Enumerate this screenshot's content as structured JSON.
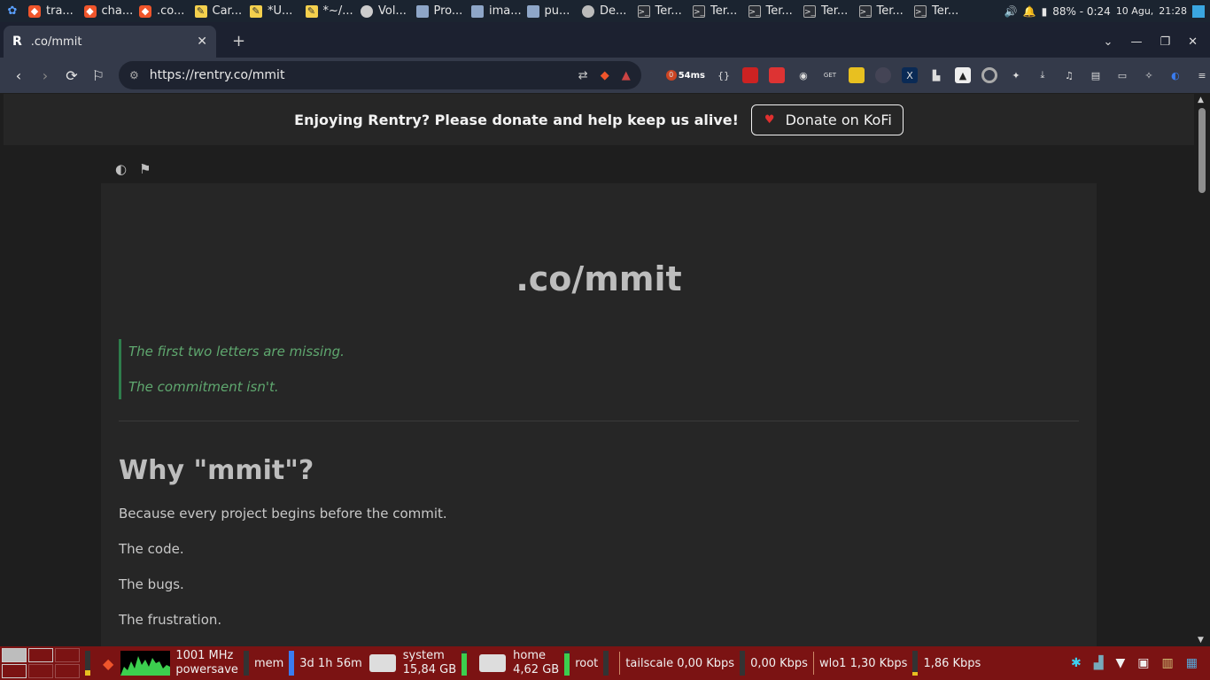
{
  "system_top": {
    "tasks": [
      {
        "label": "tra...",
        "icon": "brave-icon"
      },
      {
        "label": "cha...",
        "icon": "brave-icon"
      },
      {
        "label": ".co...",
        "icon": "brave-icon"
      },
      {
        "label": "Car...",
        "icon": "notes-icon"
      },
      {
        "label": "*U...",
        "icon": "notes-icon"
      },
      {
        "label": "*~/...",
        "icon": "notes-icon"
      },
      {
        "label": "Vol...",
        "icon": "volume-icon"
      },
      {
        "label": "Pro...",
        "icon": "folder-icon"
      },
      {
        "label": "ima...",
        "icon": "folder-icon"
      },
      {
        "label": "pu...",
        "icon": "folder-icon"
      },
      {
        "label": "De...",
        "icon": "disk-icon"
      },
      {
        "label": "Ter...",
        "icon": "terminal-icon"
      },
      {
        "label": "Ter...",
        "icon": "terminal-icon"
      },
      {
        "label": "Ter...",
        "icon": "terminal-icon"
      },
      {
        "label": "Ter...",
        "icon": "terminal-icon"
      },
      {
        "label": "Ter...",
        "icon": "terminal-icon"
      },
      {
        "label": "Ter...",
        "icon": "terminal-icon"
      }
    ],
    "battery": "88% - 0:24",
    "date": "10 Agu,",
    "time": "21:28"
  },
  "browser": {
    "tab_title": ".co/mmit",
    "tab_favicon": "R",
    "url": "https://rentry.co/mmit",
    "ping_badge": "54ms",
    "ping_count": "0"
  },
  "banner": {
    "text": "Enjoying Rentry? Please donate and help keep us alive!",
    "button": "Donate on KoFi"
  },
  "content": {
    "title": ".co/mmit",
    "quote": [
      "The first two letters are missing.",
      "The commitment isn't."
    ],
    "heading": "Why \"mmit\"?",
    "paragraphs": [
      "Because every project begins before the commit.",
      "The code.",
      "The bugs.",
      "The frustration."
    ]
  },
  "system_bottom": {
    "cpu_freq": "1001 MHz",
    "governor": "powersave",
    "mem_label": "mem",
    "uptime": "3d 1h 56m",
    "system_label": "system",
    "system_free": "15,84 GB",
    "home_label": "home",
    "home_free": "4,62 GB",
    "root_label": "root",
    "tailscale": "tailscale 0,00 Kbps",
    "tailscale_up": "0,00 Kbps",
    "wlo1": "wlo1 1,30 Kbps",
    "wlo1_up": "1,86 Kbps"
  },
  "colors": {
    "accent_green": "#2e7d4c",
    "quote_text": "#5fa86f",
    "panel_red": "#7b1313"
  }
}
